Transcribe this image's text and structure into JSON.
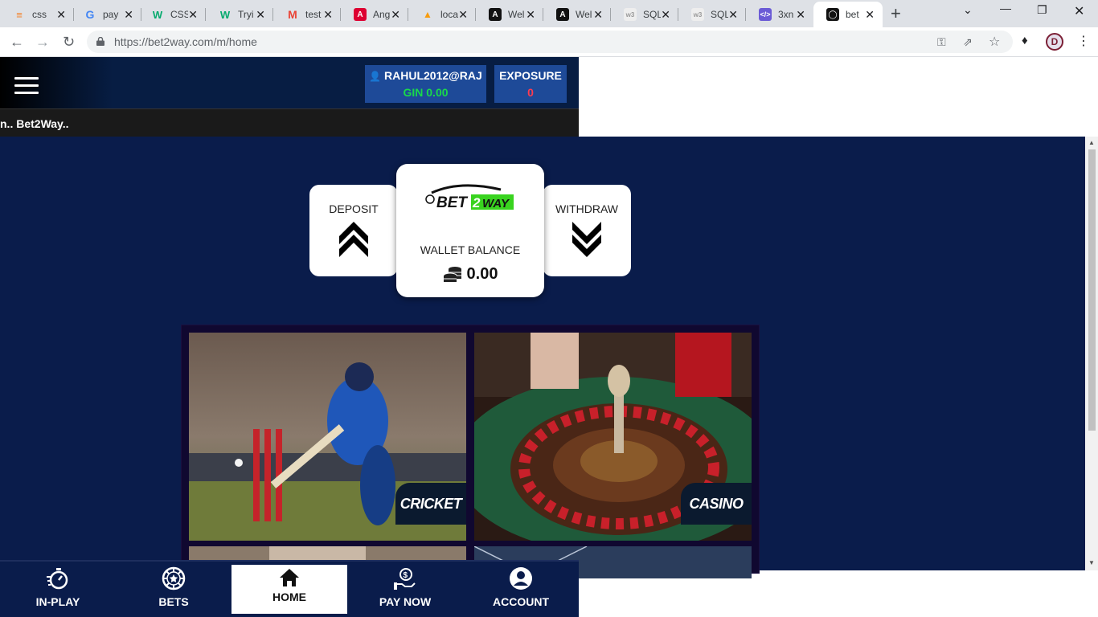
{
  "browser": {
    "tabs": [
      {
        "title": "css",
        "icon": "stackoverflow-icon",
        "color": "#f48024"
      },
      {
        "title": "pay",
        "icon": "google-icon",
        "color": "#4285f4"
      },
      {
        "title": "CSS",
        "icon": "w3-icon",
        "color": "#04aa6d"
      },
      {
        "title": "Tryi",
        "icon": "w3-icon",
        "color": "#04aa6d"
      },
      {
        "title": "test",
        "icon": "gmail-icon",
        "color": "#ea4335"
      },
      {
        "title": "Ang",
        "icon": "angular-icon",
        "color": "#dd0031"
      },
      {
        "title": "loca",
        "icon": "phpmyadmin-icon",
        "color": "#f89c0e"
      },
      {
        "title": "Wel",
        "icon": "angular-icon",
        "color": "#111111"
      },
      {
        "title": "Wel",
        "icon": "angular-icon",
        "color": "#111111"
      },
      {
        "title": "SQL",
        "icon": "w3schools-icon",
        "color": "#999999"
      },
      {
        "title": "SQL",
        "icon": "w3schools-icon",
        "color": "#999999"
      },
      {
        "title": "3xn",
        "icon": "code-icon",
        "color": "#6b5bd6"
      },
      {
        "title": "bet",
        "icon": "site-icon",
        "color": "#111111"
      }
    ],
    "url": "https://bet2way.com/m/home"
  },
  "header": {
    "username": "RAHUL2012@RAJ",
    "balance_line": "GIN 0.00",
    "exposure_label": "EXPOSURE",
    "exposure_value": "0",
    "marquee": "n.. Bet2Way.."
  },
  "wallet": {
    "deposit_label": "DEPOSIT",
    "withdraw_label": "WITHDRAW",
    "logo_text_1": "BET",
    "logo_text_2": "2",
    "logo_text_3": "WAY",
    "balance_label": "WALLET BALANCE",
    "balance_value": "0.00"
  },
  "games": [
    {
      "label": "CRICKET"
    },
    {
      "label": "CASINO"
    }
  ],
  "bottom_nav": [
    {
      "label": "IN-PLAY",
      "icon": "stopwatch-icon"
    },
    {
      "label": "BETS",
      "icon": "chip-icon"
    },
    {
      "label": "HOME",
      "icon": "home-icon",
      "active": true
    },
    {
      "label": "PAY NOW",
      "icon": "pay-hand-icon"
    },
    {
      "label": "ACCOUNT",
      "icon": "user-circle-icon"
    }
  ],
  "colors": {
    "page_bg": "#0a1c4b",
    "header_box": "#1e4a98",
    "balance_green": "#19d94a",
    "exposure_red": "#ff3b4f"
  }
}
